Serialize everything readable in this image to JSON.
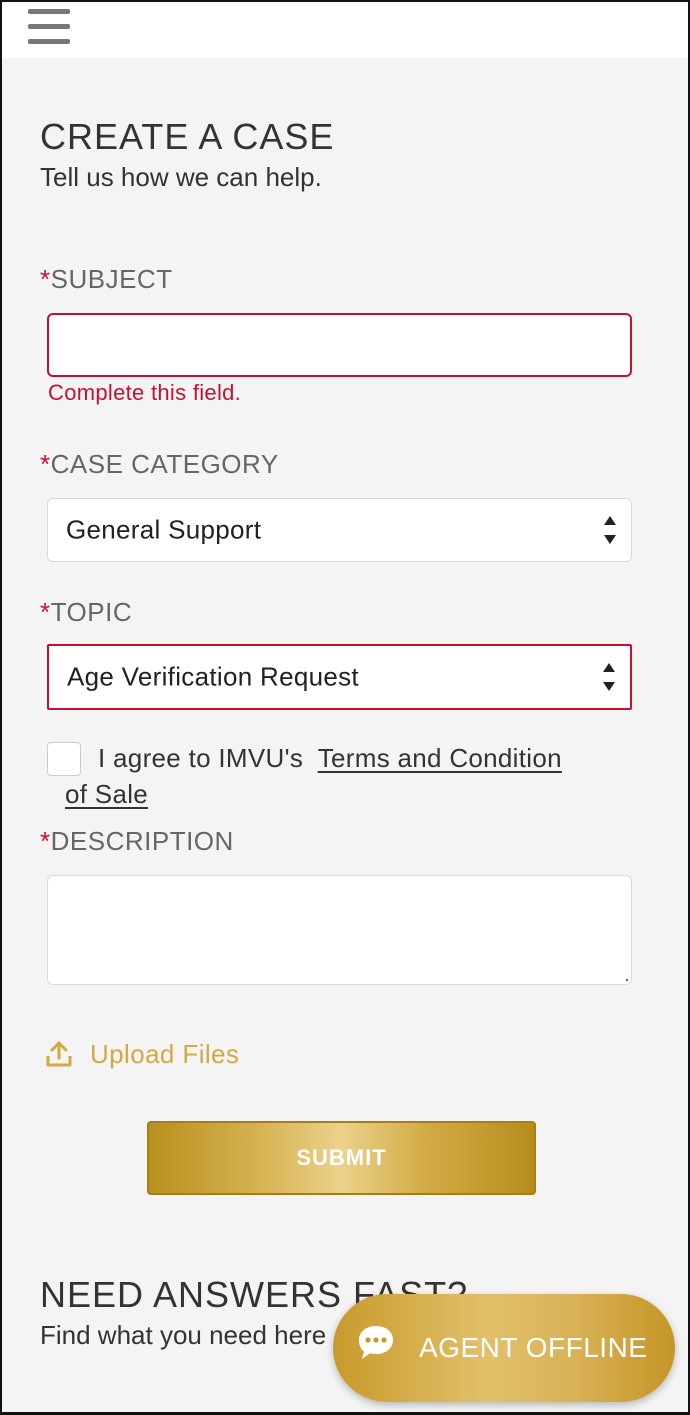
{
  "header": {
    "menu_icon": "hamburger-menu-icon"
  },
  "form": {
    "title": "CREATE A CASE",
    "subtitle": "Tell us how we can help.",
    "required_marker": "*",
    "subject": {
      "label": "SUBJECT",
      "value": "",
      "error": "Complete this field."
    },
    "category": {
      "label": "CASE CATEGORY",
      "selected": "General Support"
    },
    "topic": {
      "label": "TOPIC",
      "selected": "Age Verification Request"
    },
    "agree": {
      "checked": false,
      "text": "I agree to IMVU's",
      "link_line1": "Terms and Condition",
      "link_line2": "of Sale"
    },
    "description": {
      "label": "DESCRIPTION",
      "value": ""
    },
    "upload": {
      "label": "Upload Files",
      "icon": "upload-icon"
    },
    "submit_label": "SUBMIT"
  },
  "help": {
    "title": "NEED ANSWERS FAST?",
    "subtitle": "Find what you need here"
  },
  "agent_button": {
    "label": "AGENT OFFLINE",
    "icon": "chat-bubble-icon"
  },
  "colors": {
    "error": "#c8102e",
    "gold": "#d4a843",
    "background": "#f4f4f4"
  }
}
